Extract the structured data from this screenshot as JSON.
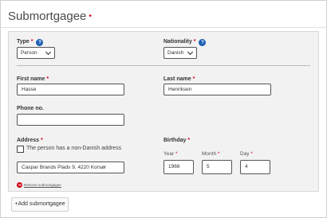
{
  "header": {
    "title": "Submortgagee",
    "required_mark": "•"
  },
  "form": {
    "type": {
      "label": "Type",
      "required": "*",
      "value": "Person"
    },
    "nationality": {
      "label": "Nationality",
      "required": "*",
      "value": "Danish"
    },
    "first_name": {
      "label": "First name",
      "required": "*",
      "value": "Hasse"
    },
    "last_name": {
      "label": "Last name",
      "required": "*",
      "value": "Henriksen"
    },
    "phone": {
      "label": "Phone no.",
      "value": ""
    },
    "address": {
      "label": "Address",
      "required": "*",
      "non_danish_label": "The person has a non-Danish address",
      "value": "Caspar Brands Plads 9, 4220 Korsør"
    },
    "birthday": {
      "label": "Birthday",
      "required": "*",
      "year_label": "Year",
      "month_label": "Month",
      "day_label": "Day",
      "req": "*",
      "year": "1966",
      "month": "5",
      "day": "4"
    },
    "remove_label": "Remove submortgagee"
  },
  "actions": {
    "add_label": "+Add submortgagee"
  },
  "colors": {
    "required": "#d0021b",
    "help": "#1a5fb4"
  }
}
